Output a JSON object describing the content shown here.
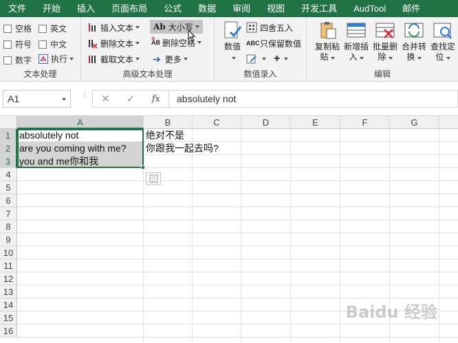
{
  "ribbon_tabs": [
    "文件",
    "开始",
    "插入",
    "页面布局",
    "公式",
    "数据",
    "审阅",
    "视图",
    "开发工具",
    "AudTool",
    "邮件"
  ],
  "group_text": {
    "label": "文本处理",
    "checkboxes": [
      "空格",
      "英文",
      "符号",
      "中文",
      "数字"
    ],
    "exec_label": "执行"
  },
  "group_adv": {
    "label": "高级文本处理",
    "insert_text": "插入文本",
    "delete_text": "删除文本",
    "extract_text": "截取文本",
    "case_icon": "Ab",
    "case_label": "大小写",
    "delete_space": "删除空格",
    "more": "更多"
  },
  "group_num": {
    "label": "数值录入",
    "value_label": "数值",
    "round_label": "四舍五入",
    "keep_value_label": "只保留数值"
  },
  "group_edit": {
    "label": "编辑",
    "buttons": [
      {
        "l1": "复制粘",
        "l2": "贴"
      },
      {
        "l1": "新增插",
        "l2": "入"
      },
      {
        "l1": "批量删",
        "l2": "除"
      },
      {
        "l1": "合并转",
        "l2": "换"
      },
      {
        "l1": "查找定",
        "l2": "位"
      }
    ]
  },
  "formula_bar": {
    "name_box": "A1",
    "cancel_glyph": "✕",
    "enter_glyph": "✓",
    "fx": "fx",
    "content": "absolutely not"
  },
  "columns": [
    "A",
    "B",
    "C",
    "D",
    "E",
    "F",
    "G"
  ],
  "rows": [
    "1",
    "2",
    "3",
    "4",
    "5",
    "6",
    "7",
    "8",
    "9",
    "10",
    "11",
    "12",
    "13",
    "14",
    "15",
    "16"
  ],
  "cells": {
    "A1": "absolutely not",
    "A2": "are you coming with me?",
    "A3": "you and me你和我",
    "B1": "绝对不是",
    "B2": "你跟我一起去吗?"
  },
  "watermark": "Baidu 经验",
  "colors": {
    "ribbon_green": "#217346",
    "selection": "#217346"
  }
}
